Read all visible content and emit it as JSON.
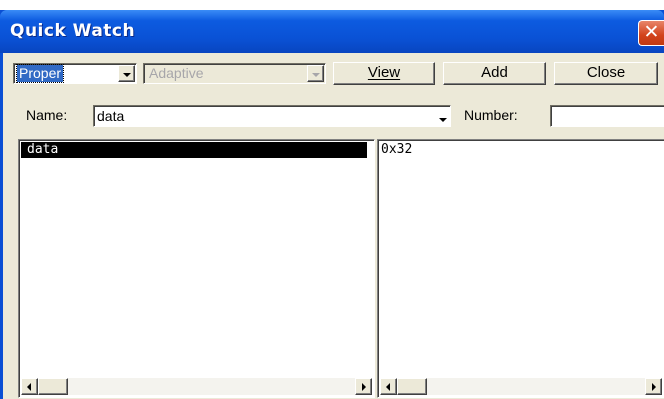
{
  "window": {
    "title": "Quick Watch"
  },
  "toolbar": {
    "mode_value": "Proper",
    "adaptive_value": "Adaptive",
    "view_label": "View",
    "add_label": "Add",
    "close_label": "Close"
  },
  "name_row": {
    "name_label": "Name:",
    "name_value": "data",
    "number_label": "Number:",
    "number_value": ""
  },
  "symbols": {
    "selected_item": "data"
  },
  "values": {
    "text": "0x32"
  },
  "colors": {
    "titlebar": "#0a52d6",
    "close_button": "#d2421b",
    "client_bg": "#ece9d8",
    "selection_bg": "#000000"
  },
  "icons": [
    "close-icon",
    "chevron-down-icon",
    "scroll-left-arrow-icon",
    "scroll-right-arrow-icon"
  ]
}
